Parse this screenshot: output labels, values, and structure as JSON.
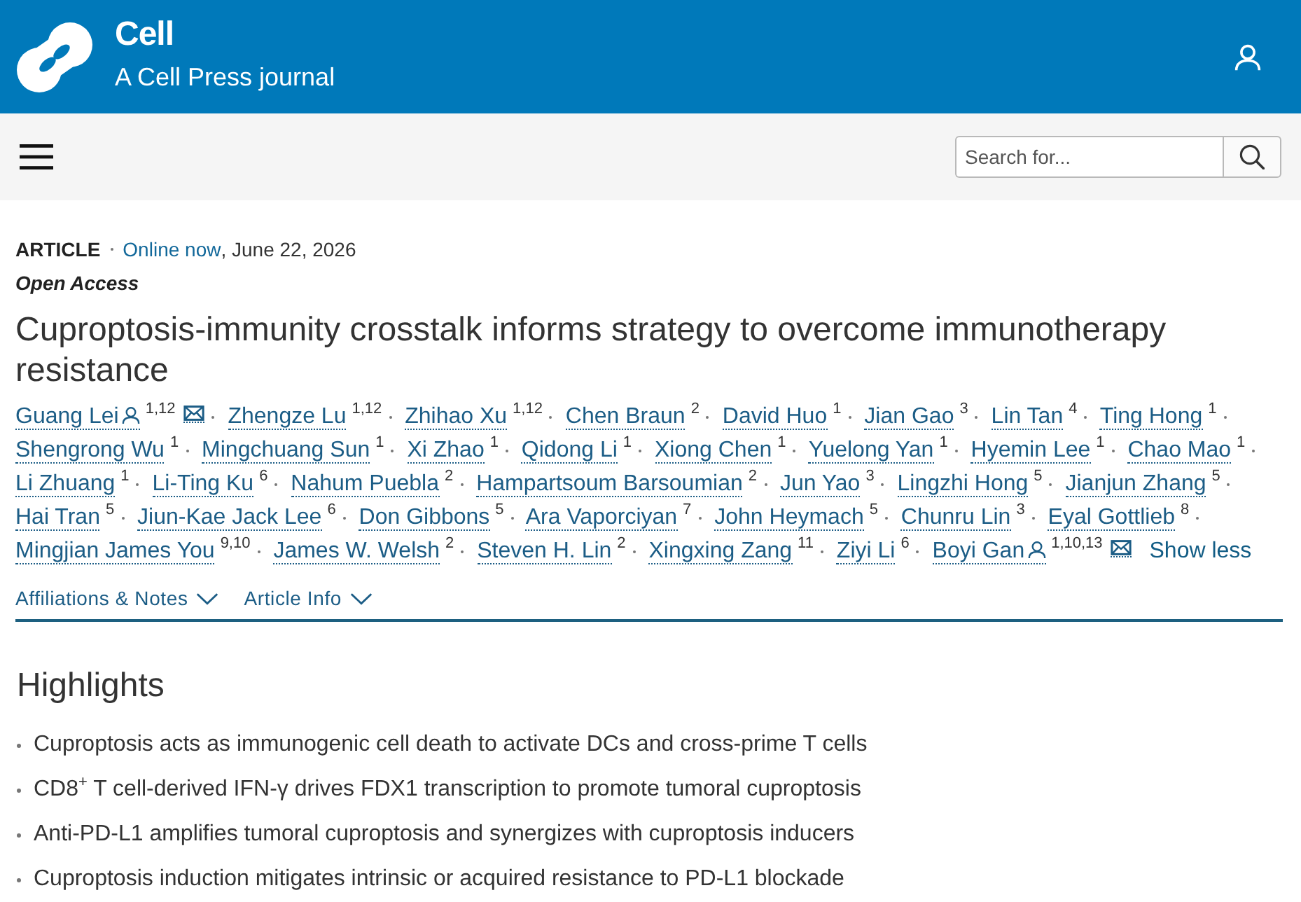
{
  "header": {
    "title": "Cell",
    "subtitle": "A Cell Press journal"
  },
  "toolbar": {
    "search": {
      "placeholder": "Search for..."
    }
  },
  "article": {
    "type": "ARTICLE",
    "online_link": "Online now",
    "date": ", June 22, 2026",
    "access": "Open Access",
    "title": "Cuproptosis-immunity crosstalk informs strategy to overcome immunotherapy resistance",
    "authors": [
      {
        "name": "Guang Lei",
        "affiliations": "1,12",
        "corresponding": true
      },
      {
        "name": "Zhengze Lu",
        "affiliations": "1,12",
        "corresponding": false
      },
      {
        "name": "Zhihao Xu",
        "affiliations": "1,12",
        "corresponding": false
      },
      {
        "name": "Chen Braun",
        "affiliations": "2",
        "corresponding": false
      },
      {
        "name": "David Huo",
        "affiliations": "1",
        "corresponding": false
      },
      {
        "name": "Jian Gao",
        "affiliations": "3",
        "corresponding": false
      },
      {
        "name": "Lin Tan",
        "affiliations": "4",
        "corresponding": false
      },
      {
        "name": "Ting Hong",
        "affiliations": "1",
        "corresponding": false
      },
      {
        "name": "Shengrong Wu",
        "affiliations": "1",
        "corresponding": false
      },
      {
        "name": "Mingchuang Sun",
        "affiliations": "1",
        "corresponding": false
      },
      {
        "name": "Xi Zhao",
        "affiliations": "1",
        "corresponding": false
      },
      {
        "name": "Qidong Li",
        "affiliations": "1",
        "corresponding": false
      },
      {
        "name": "Xiong Chen",
        "affiliations": "1",
        "corresponding": false
      },
      {
        "name": "Yuelong Yan",
        "affiliations": "1",
        "corresponding": false
      },
      {
        "name": "Hyemin Lee",
        "affiliations": "1",
        "corresponding": false
      },
      {
        "name": "Chao Mao",
        "affiliations": "1",
        "corresponding": false
      },
      {
        "name": "Li Zhuang",
        "affiliations": "1",
        "corresponding": false
      },
      {
        "name": "Li-Ting Ku",
        "affiliations": "6",
        "corresponding": false
      },
      {
        "name": "Nahum Puebla",
        "affiliations": "2",
        "corresponding": false
      },
      {
        "name": "Hampartsoum Barsoumian",
        "affiliations": "2",
        "corresponding": false
      },
      {
        "name": "Jun Yao",
        "affiliations": "3",
        "corresponding": false
      },
      {
        "name": "Lingzhi Hong",
        "affiliations": "5",
        "corresponding": false
      },
      {
        "name": "Jianjun Zhang",
        "affiliations": "5",
        "corresponding": false
      },
      {
        "name": "Hai Tran",
        "affiliations": "5",
        "corresponding": false
      },
      {
        "name": "Jiun-Kae Jack Lee",
        "affiliations": "6",
        "corresponding": false
      },
      {
        "name": "Don Gibbons",
        "affiliations": "5",
        "corresponding": false
      },
      {
        "name": "Ara Vaporciyan",
        "affiliations": "7",
        "corresponding": false
      },
      {
        "name": "John Heymach",
        "affiliations": "5",
        "corresponding": false
      },
      {
        "name": "Chunru Lin",
        "affiliations": "3",
        "corresponding": false
      },
      {
        "name": "Eyal Gottlieb",
        "affiliations": "8",
        "corresponding": false
      },
      {
        "name": "Mingjian James You",
        "affiliations": "9,10",
        "corresponding": false
      },
      {
        "name": "James W. Welsh",
        "affiliations": "2",
        "corresponding": false
      },
      {
        "name": "Steven H. Lin",
        "affiliations": "2",
        "corresponding": false
      },
      {
        "name": "Xingxing Zang",
        "affiliations": "11",
        "corresponding": false
      },
      {
        "name": "Ziyi Li",
        "affiliations": "6",
        "corresponding": false
      },
      {
        "name": "Boyi Gan",
        "affiliations": "1,10,13",
        "corresponding": true
      }
    ],
    "show_less": "Show less",
    "tabs": [
      {
        "label": "Affiliations & Notes",
        "expanded": false
      },
      {
        "label": "Article Info",
        "expanded": false
      }
    ]
  },
  "highlights": {
    "heading": "Highlights",
    "items": [
      "Cuproptosis acts as immunogenic cell death to activate DCs and cross-prime T cells",
      "CD8$^{+}$ T cell-derived IFN-γ drives FDX1 transcription to promote tumoral cuproptosis",
      "Anti-PD-L1 amplifies tumoral cuproptosis and synergizes with cuproptosis inducers",
      "Cuproptosis induction mitigates intrinsic or acquired resistance to PD-L1 blockade"
    ]
  }
}
